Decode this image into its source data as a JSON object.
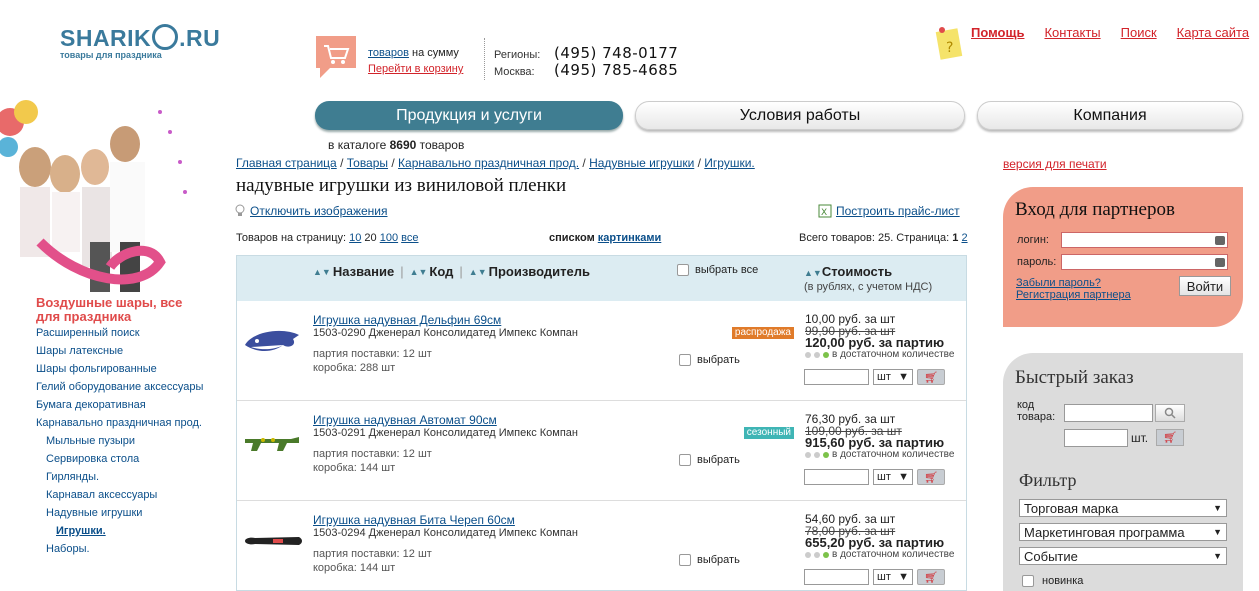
{
  "logo": {
    "name": "SHARIK",
    "tld": ".RU",
    "tagline": "товары для праздника"
  },
  "cart": {
    "items_link": "товаров",
    "items_suffix": " на сумму",
    "go_cart": "Перейти в корзину"
  },
  "phones": {
    "regions_label": "Регионы:",
    "regions_number": "(495) 748-0177",
    "moscow_label": "Москва:",
    "moscow_number": "(495) 785-4685"
  },
  "toplinks": {
    "help": "Помощь",
    "contacts": "Контакты",
    "search": "Поиск",
    "sitemap": "Карта сайта"
  },
  "nav": {
    "products": "Продукция и услуги",
    "terms": "Условия работы",
    "company": "Компания"
  },
  "catalog": {
    "prefix": "в каталоге ",
    "count": "8690",
    "suffix": " товаров"
  },
  "left_menu": {
    "title": "Воздушные шары, все для праздника",
    "items": [
      {
        "label": "Расширенный поиск"
      },
      {
        "label": "Шары латексные"
      },
      {
        "label": "Шары фольгированные"
      },
      {
        "label": "Гелий оборудование аксессуары"
      },
      {
        "label": "Бумага декоративная"
      },
      {
        "label": "Карнавально праздничная прод."
      },
      {
        "label": "Мыльные пузыри"
      },
      {
        "label": "Сервировка стола"
      },
      {
        "label": "Гирлянды."
      },
      {
        "label": "Карнавал аксессуары"
      },
      {
        "label": "Надувные игрушки"
      },
      {
        "label": "Игрушки."
      },
      {
        "label": "Наборы."
      }
    ]
  },
  "breadcrumb": {
    "home": "Главная страница",
    "goods": "Товары",
    "carnival": "Карнавально праздничная прод.",
    "inflatable": "Надувные игрушки",
    "toys": "Игрушки.",
    "sep": " / "
  },
  "page": {
    "title": "надувные игрушки из виниловой пленки",
    "print": "версия для печати",
    "toggle_images": "Отключить изображения",
    "price_list": "Построить прайс-лист"
  },
  "paging": {
    "perpage_label": "Товаров на страницу: ",
    "p10": "10",
    "p20": "20",
    "p100": "100",
    "all": "все",
    "view_label": "списком",
    "view_cards": "картинками",
    "totals": "Всего товаров: 25. Страница: ",
    "page1": "1",
    "page2": "2"
  },
  "table": {
    "col_name": "Название",
    "col_code": "Код",
    "col_maker": "Производитель",
    "select_all": "выбрать все",
    "col_price": "Стоимость",
    "col_price_note": "(в рублях, с учетом НДС)",
    "rows": [
      {
        "name": "Игрушка надувная Дельфин 69см",
        "code": "1503-0290 Дженерал Консолидатед Импекс Компан",
        "lot": "партия поставки: 12 шт",
        "box": "коробка: 288 шт",
        "tag": "распродажа",
        "tag_color": "#e07b2a",
        "unit_price": "10,00 руб. за шт",
        "old_price": "99,90 руб. за шт",
        "lot_price": "120,00 руб. за партию",
        "stock": "в достаточном количестве",
        "select": "выбрать",
        "unit": "шт"
      },
      {
        "name": "Игрушка надувная Автомат 90см",
        "code": "1503-0291 Дженерал Консолидатед Импекс Компан",
        "lot": "партия поставки: 12 шт",
        "box": "коробка: 144 шт",
        "tag": "сезонный",
        "tag_color": "#3fb5b5",
        "unit_price": "76,30 руб. за шт",
        "old_price": "109,00 руб. за шт",
        "lot_price": "915,60 руб. за партию",
        "stock": "в достаточном количестве",
        "select": "выбрать",
        "unit": "шт"
      },
      {
        "name": "Игрушка надувная Бита Череп 60см",
        "code": "1503-0294 Дженерал Консолидатед Импекс Компан",
        "lot": "партия поставки: 12 шт",
        "box": "коробка: 144 шт",
        "tag": "",
        "tag_color": "",
        "unit_price": "54,60 руб. за шт",
        "old_price": "78,00 руб. за шт",
        "lot_price": "655,20 руб. за партию",
        "stock": "в достаточном количестве",
        "select": "выбрать",
        "unit": "шт"
      }
    ]
  },
  "partner": {
    "title": "Вход для партнеров",
    "login": "логин:",
    "password": "пароль:",
    "forgot": "Забыли пароль?",
    "register": "Регистрация партнера",
    "submit": "Войти"
  },
  "quick": {
    "title": "Быстрый заказ",
    "code_label_1": "код",
    "code_label_2": "товара:",
    "qty_unit": "шт.",
    "filter_title": "Фильтр",
    "brand": "Торговая марка",
    "marketing": "Маркетинговая программа",
    "event": "Событие",
    "new": "новинка"
  },
  "colors": {
    "accent": "#3f7d91",
    "link": "#0b4f8a",
    "red_link": "#d2232a",
    "partner_bg": "#f19d88"
  }
}
